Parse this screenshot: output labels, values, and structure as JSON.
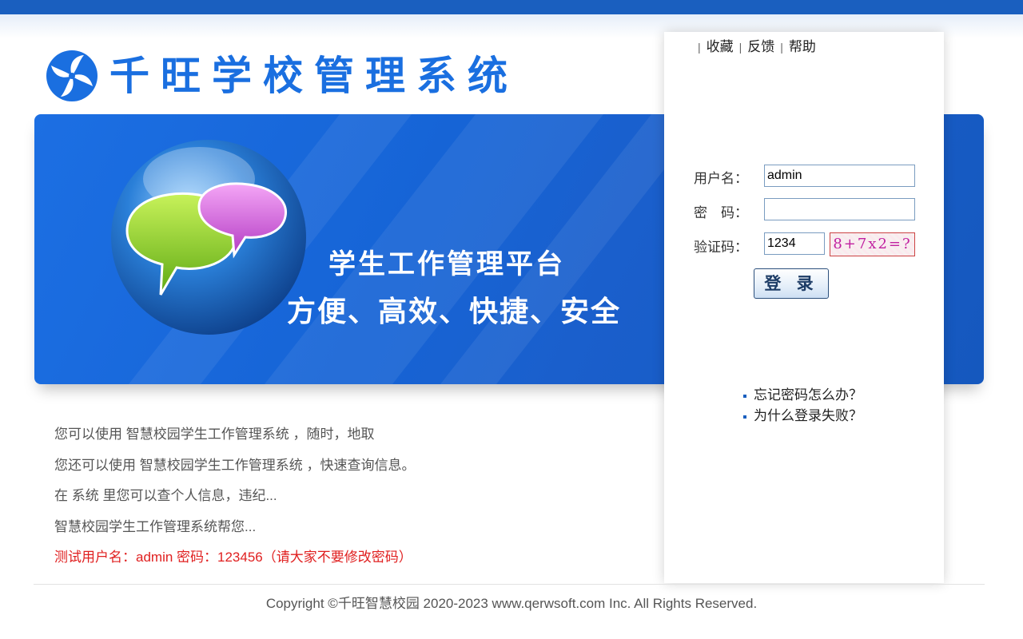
{
  "header": {
    "logo_text": "千旺学校管理系统",
    "links": [
      "收藏",
      "反馈",
      "帮助"
    ],
    "accent_color": "#1a5fbf"
  },
  "banner": {
    "title": "学生工作管理平台",
    "subtitle": "方便、高效、快捷、安全",
    "icon": "chat-bubbles-globe-icon"
  },
  "login": {
    "username_label": "用户名：",
    "username_value": "admin",
    "password_label": "密　码：",
    "password_value": "",
    "captcha_label": "验证码：",
    "captcha_value": "1234",
    "captcha_image_text": "8+7x2=?",
    "submit_label": "登 录"
  },
  "help": {
    "links": [
      "忘记密码怎么办？",
      "为什么登录失败？"
    ]
  },
  "info": {
    "lines": [
      "您可以使用 智慧校园学生工作管理系统 ，随时，地取",
      "您还可以使用 智慧校园学生工作管理系统 ，快速查询信息。",
      "在 系统 里您可以查个人信息，违纪...",
      "智慧校园学生工作管理系统帮您..."
    ],
    "test_notice": "测试用户名：admin 密码：123456（请大家不要修改密码）"
  },
  "footer": {
    "copyright": "Copyright ©千旺智慧校园 2020-2023 www.qerwsoft.com Inc. All Rights Reserved."
  }
}
